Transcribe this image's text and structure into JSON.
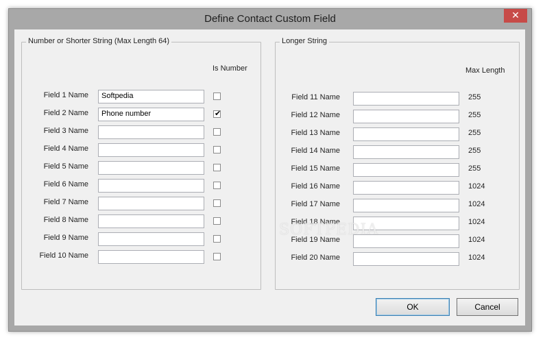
{
  "window": {
    "title": "Define Contact Custom Field",
    "close_glyph": "✕"
  },
  "left_group": {
    "legend": "Number or Shorter String (Max Length 64)",
    "is_number_header": "Is Number",
    "fields": [
      {
        "label": "Field 1 Name",
        "value": "Softpedia",
        "is_number": false
      },
      {
        "label": "Field 2 Name",
        "value": "Phone number",
        "is_number": true
      },
      {
        "label": "Field 3 Name",
        "value": "",
        "is_number": false
      },
      {
        "label": "Field 4 Name",
        "value": "",
        "is_number": false
      },
      {
        "label": "Field 5 Name",
        "value": "",
        "is_number": false
      },
      {
        "label": "Field 6 Name",
        "value": "",
        "is_number": false
      },
      {
        "label": "Field 7 Name",
        "value": "",
        "is_number": false
      },
      {
        "label": "Field 8 Name",
        "value": "",
        "is_number": false
      },
      {
        "label": "Field 9 Name",
        "value": "",
        "is_number": false
      },
      {
        "label": "Field 10 Name",
        "value": "",
        "is_number": false
      }
    ]
  },
  "right_group": {
    "legend": "Longer String",
    "max_length_header": "Max Length",
    "fields": [
      {
        "label": "Field 11 Name",
        "value": "",
        "max_length": "255"
      },
      {
        "label": "Field 12 Name",
        "value": "",
        "max_length": "255"
      },
      {
        "label": "Field 13 Name",
        "value": "",
        "max_length": "255"
      },
      {
        "label": "Field 14 Name",
        "value": "",
        "max_length": "255"
      },
      {
        "label": "Field 15 Name",
        "value": "",
        "max_length": "255"
      },
      {
        "label": "Field 16 Name",
        "value": "",
        "max_length": "1024"
      },
      {
        "label": "Field 17 Name",
        "value": "",
        "max_length": "1024"
      },
      {
        "label": "Field 18 Name",
        "value": "",
        "max_length": "1024"
      },
      {
        "label": "Field 19 Name",
        "value": "",
        "max_length": "1024"
      },
      {
        "label": "Field 20 Name",
        "value": "",
        "max_length": "1024"
      }
    ]
  },
  "buttons": {
    "ok": "OK",
    "cancel": "Cancel"
  },
  "watermark": "SOFTPEDIA",
  "check_glyph": "✔"
}
